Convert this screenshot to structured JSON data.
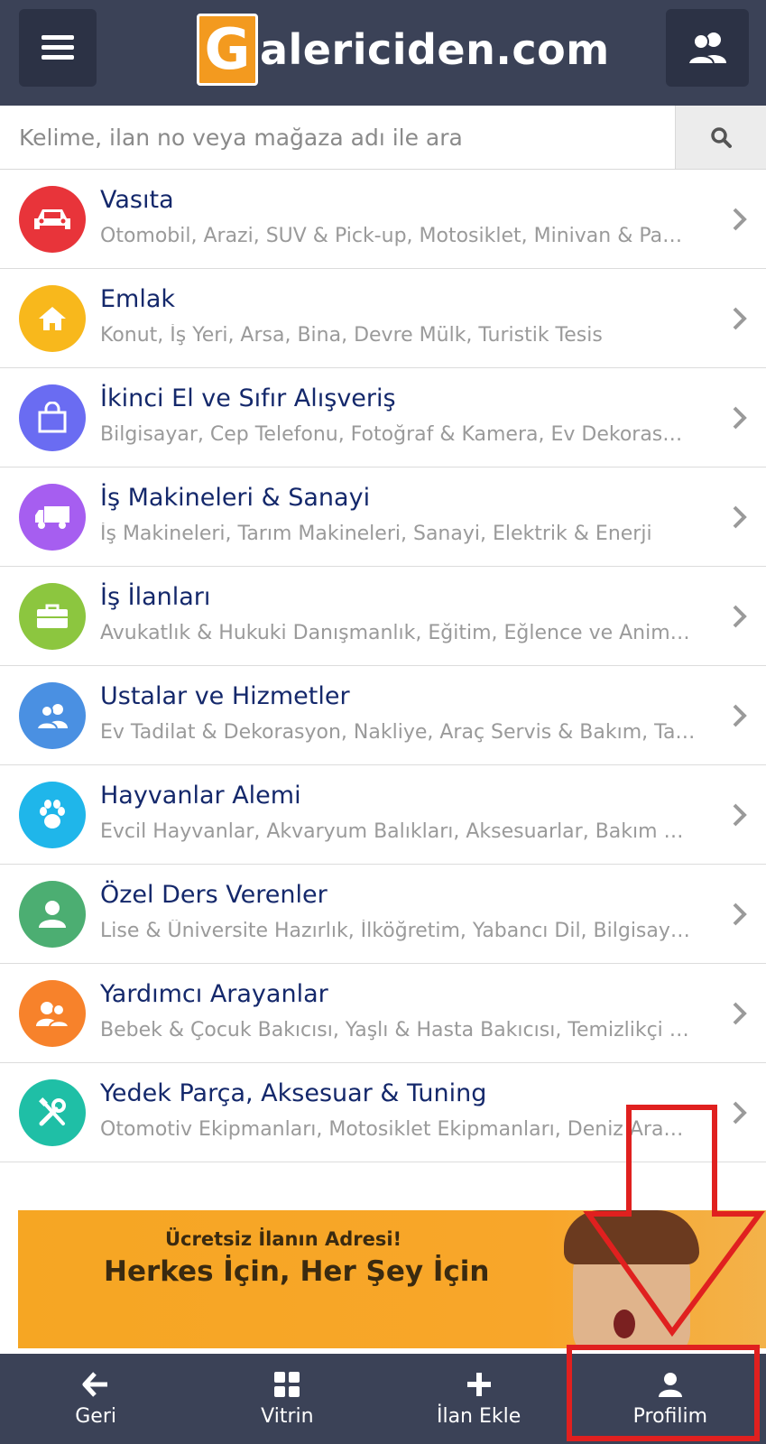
{
  "header": {
    "logo_letter": "G",
    "logo_text": "alericiden.com",
    "menu_icon": "hamburger-menu-icon",
    "users_icon": "users-icon"
  },
  "search": {
    "placeholder": "Kelime, ilan no veya mağaza adı ile ara",
    "icon": "search-icon"
  },
  "categories": [
    {
      "title": "Vasıta",
      "subtitle": "Otomobil, Arazi, SUV & Pick-up, Motosiklet, Minivan & Pa…",
      "icon": "car-icon",
      "color": "#e8343a"
    },
    {
      "title": "Emlak",
      "subtitle": "Konut, İş Yeri, Arsa, Bina, Devre Mülk, Turistik Tesis",
      "icon": "home-icon",
      "color": "#f8b81c"
    },
    {
      "title": "İkinci El ve Sıfır Alışveriş",
      "subtitle": "Bilgisayar, Cep Telefonu, Fotoğraf & Kamera, Ev Dekoras…",
      "icon": "shopping-bag-icon",
      "color": "#6a6cf2"
    },
    {
      "title": "İş Makineleri & Sanayi",
      "subtitle": "İş Makineleri, Tarım Makineleri, Sanayi, Elektrik & Enerji",
      "icon": "truck-icon",
      "color": "#a65ef0"
    },
    {
      "title": "İş İlanları",
      "subtitle": "Avukatlık & Hukuki Danışmanlık, Eğitim, Eğlence ve Anim…",
      "icon": "briefcase-icon",
      "color": "#8cc63f"
    },
    {
      "title": "Ustalar ve Hizmetler",
      "subtitle": "Ev Tadilat & Dekorasyon, Nakliye, Araç Servis & Bakım, Ta…",
      "icon": "workers-icon",
      "color": "#4a90e2"
    },
    {
      "title": "Hayvanlar Alemi",
      "subtitle": "Evcil Hayvanlar, Akvaryum Balıkları, Aksesuarlar, Bakım Ü…",
      "icon": "paw-icon",
      "color": "#1fb6ea"
    },
    {
      "title": "Özel Ders Verenler",
      "subtitle": "Lise & Üniversite Hazırlık, İlköğretim, Yabancı Dil, Bilgisay…",
      "icon": "person-icon",
      "color": "#4cae72"
    },
    {
      "title": "Yardımcı Arayanlar",
      "subtitle": "Bebek & Çocuk Bakıcısı, Yaşlı & Hasta Bakıcısı, Temizlikçi …",
      "icon": "helpers-icon",
      "color": "#f7822b"
    },
    {
      "title": "Yedek Parça, Aksesuar & Tuning",
      "subtitle": "Otomotiv Ekipmanları, Motosiklet Ekipmanları, Deniz Ara…",
      "icon": "tools-icon",
      "color": "#1fbfa6"
    }
  ],
  "banner": {
    "line1": "Ücretsiz İlanın Adresi!",
    "line2": "Herkes İçin, Her Şey İçin"
  },
  "bottom_nav": [
    {
      "label": "Geri",
      "icon": "arrow-left-icon"
    },
    {
      "label": "Vitrin",
      "icon": "grid-icon"
    },
    {
      "label": "İlan Ekle",
      "icon": "plus-icon"
    },
    {
      "label": "Profilim",
      "icon": "user-icon"
    }
  ],
  "colors": {
    "header_bg": "#3b4257",
    "title_text": "#14286b",
    "subtitle_text": "#9a9a9a",
    "annotation_red": "#e0201f",
    "brand_orange": "#f39a1f"
  }
}
